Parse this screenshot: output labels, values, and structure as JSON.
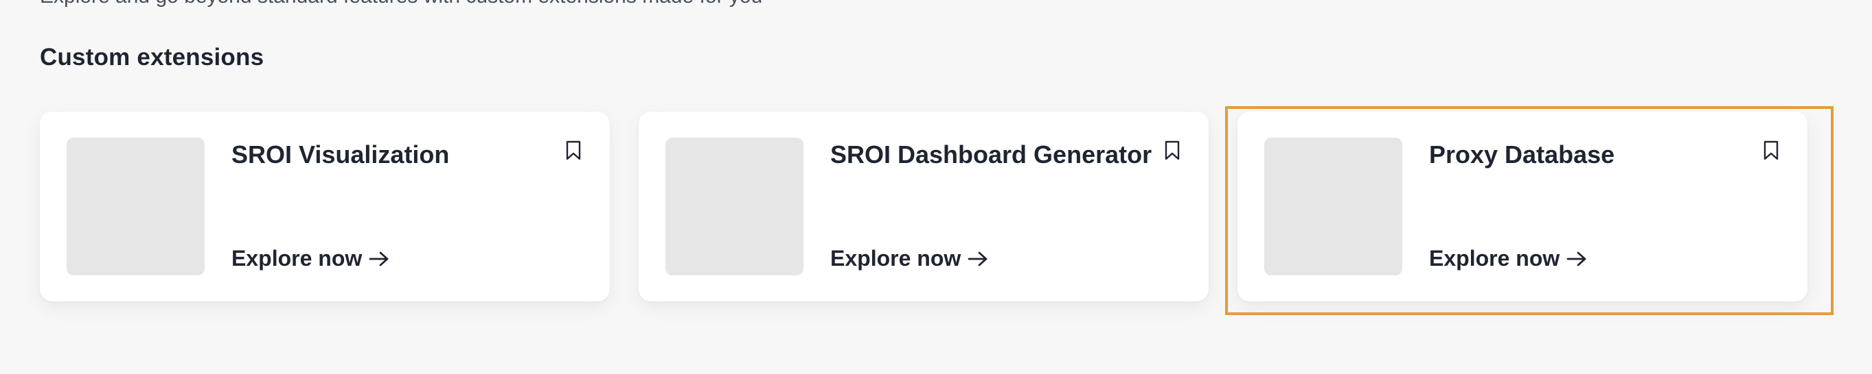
{
  "page": {
    "top_text": "Explore and go beyond standard features with custom extensions made for you"
  },
  "section": {
    "title": "Custom extensions"
  },
  "cards": [
    {
      "title": "SROI Visualization",
      "cta": "Explore now",
      "bookmark_icon": "bookmark-icon",
      "arrow_icon": "arrow-right-icon"
    },
    {
      "title": "SROI Dashboard Generator",
      "cta": "Explore now",
      "bookmark_icon": "bookmark-icon",
      "arrow_icon": "arrow-right-icon"
    },
    {
      "title": "Proxy Database",
      "cta": "Explore now",
      "bookmark_icon": "bookmark-icon",
      "arrow_icon": "arrow-right-icon",
      "highlighted": true
    }
  ],
  "colors": {
    "background": "#f6f7f6",
    "card": "#ffffff",
    "thumbnail": "#e6e6e6",
    "text": "#1f2430",
    "highlight": "#e89a3c"
  }
}
